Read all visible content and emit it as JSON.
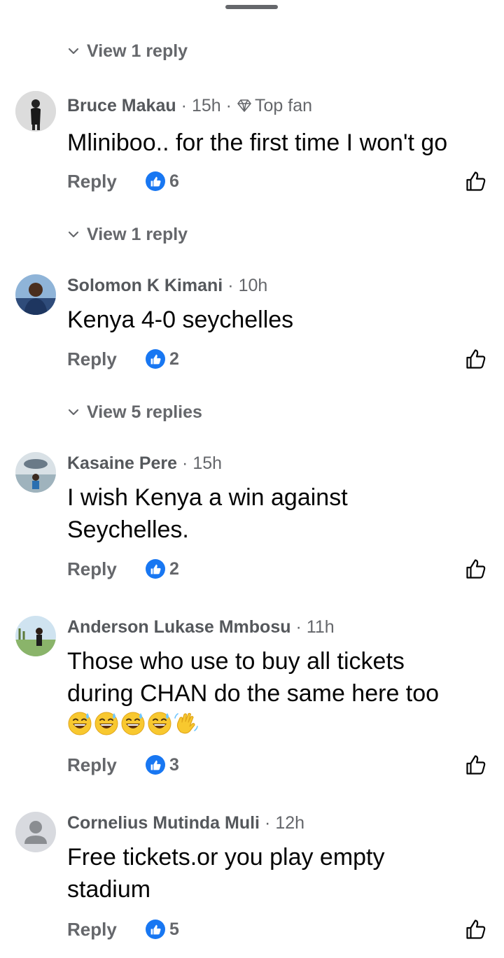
{
  "view_replies": [
    {
      "label": "View 1 reply"
    },
    {
      "label": "View 1 reply"
    },
    {
      "label": "View 5 replies"
    }
  ],
  "comments": [
    {
      "author": "Bruce Makau",
      "time": "15h",
      "badge": "Top fan",
      "text": "Mliniboo.. for the first time I won't go",
      "reply": "Reply",
      "likes": "6"
    },
    {
      "author": "Solomon K Kimani",
      "time": "10h",
      "text": "Kenya 4-0 seychelles",
      "reply": "Reply",
      "likes": "2"
    },
    {
      "author": "Kasaine Pere",
      "time": "15h",
      "text_lines": [
        "I wish Kenya  a win against",
        "Seychelles."
      ],
      "reply": "Reply",
      "likes": "2"
    },
    {
      "author": "Anderson Lukase Mmbosu",
      "time": "11h",
      "text_lines": [
        "Those who use to buy all tickets",
        "during  CHAN  do the same here too"
      ],
      "emojis": [
        "sweat-smile-emoji",
        "sweat-smile-emoji",
        "sweat-smile-emoji",
        "sweat-smile-emoji",
        "waving-hand-emoji"
      ],
      "reply": "Reply",
      "likes": "3"
    },
    {
      "author": "Cornelius Mutinda Muli",
      "time": "12h",
      "text_lines": [
        "Free tickets.or you play empty",
        "stadium"
      ],
      "reply": "Reply",
      "likes": "5"
    }
  ],
  "colors": {
    "like_blue": "#1877f2",
    "secondary_text": "#65676b",
    "primary_text": "#050505"
  },
  "icons": {
    "chevron": "chevron-down-icon",
    "like": "thumbs-up-icon",
    "badge": "diamond-icon"
  }
}
